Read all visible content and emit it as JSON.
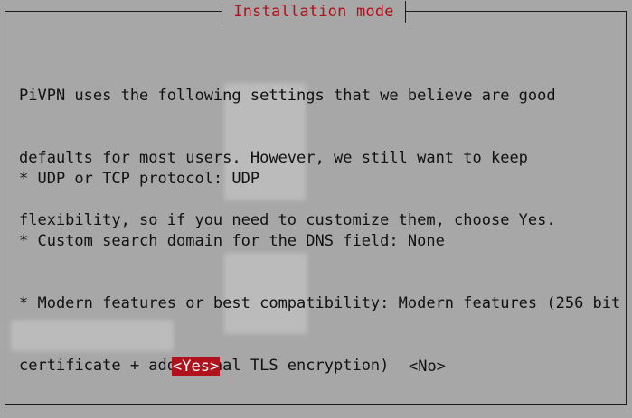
{
  "dialog": {
    "title": "Installation mode",
    "intro_lines": [
      "PiVPN uses the following settings that we believe are good",
      "defaults for most users. However, we still want to keep",
      "flexibility, so if you need to customize them, choose Yes."
    ],
    "settings_lines": [
      "* UDP or TCP protocol: UDP",
      "* Custom search domain for the DNS field: None",
      "* Modern features or best compatibility: Modern features (256 bit",
      "certificate + additional TLS encryption)"
    ],
    "buttons": {
      "yes_label": "<Yes>",
      "no_label": "<No>"
    }
  },
  "colors": {
    "background": "#a7a7a7",
    "accent": "#b0111b",
    "text": "#111111"
  }
}
